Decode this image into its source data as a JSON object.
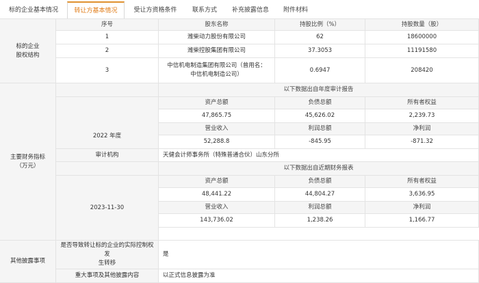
{
  "tabs": [
    {
      "label": "标的企业基本情况"
    },
    {
      "label": "转让方基本情况"
    },
    {
      "label": "受让方资格条件"
    },
    {
      "label": "联系方式"
    },
    {
      "label": "补充披露信息"
    },
    {
      "label": "附件材料"
    }
  ],
  "active_tab": "转让方基本情况",
  "colors": {
    "accent": "#e07b16",
    "border": "#e3e3e3",
    "label_bg": "#f5f5f5"
  },
  "equity": {
    "section_label": "标的企业\n股权结构",
    "headers": [
      "序号",
      "股东名称",
      "持股比例（%）",
      "持股数量（股）"
    ],
    "rows": [
      {
        "no": "1",
        "name": "潍柴动力股份有限公司",
        "ratio": "62",
        "shares": "18600000"
      },
      {
        "no": "2",
        "name": "潍柴控股集团有限公司",
        "ratio": "37.3053",
        "shares": "11191580"
      },
      {
        "no": "3",
        "name": "中信机电制造集团有限公司（曾用名：\n中信机电制造公司）",
        "ratio": "0.6947",
        "shares": "208420"
      }
    ]
  },
  "finance": {
    "section_label": "主要财务指标\n（万元）",
    "annual": {
      "caption": "以下数据出自年度审计报告",
      "period": "2022 年度",
      "head1": [
        "资产总额",
        "负债总额",
        "所有者权益"
      ],
      "vals1": [
        "47,865.75",
        "45,626.02",
        "2,239.73"
      ],
      "head2": [
        "营业收入",
        "利润总额",
        "净利润"
      ],
      "vals2": [
        "52,288.8",
        "-845.95",
        "-871.32"
      ]
    },
    "audit": {
      "label": "审计机构",
      "value": "天健会计师事务所（特殊普通合伙）山东分所"
    },
    "recent": {
      "caption": "以下数据出自近期财务报表",
      "period": "2023-11-30",
      "head1": [
        "资产总额",
        "负债总额",
        "所有者权益"
      ],
      "vals1": [
        "48,441.22",
        "44,804.27",
        "3,636.95"
      ],
      "head2": [
        "营业收入",
        "利润总额",
        "净利润"
      ],
      "vals2": [
        "143,736.02",
        "1,238.26",
        "1,166.77"
      ]
    }
  },
  "other": {
    "section_label": "其他披露事项",
    "q1": "是否导致转让标的企业的实际控制权发\n生转移",
    "a1": "是",
    "q2": "重大事项及其他披露内容",
    "a2": "以正式信息披露为准"
  }
}
